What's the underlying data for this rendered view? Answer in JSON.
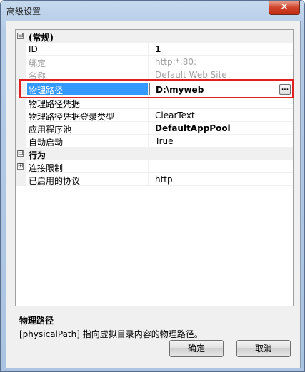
{
  "window": {
    "title": "高级设置",
    "close_symbol": "✕"
  },
  "grid": {
    "rows": [
      {
        "kind": "category",
        "expander": "⊟",
        "label": "(常规)"
      },
      {
        "kind": "prop",
        "name": "ID",
        "value": "1",
        "style": "bold"
      },
      {
        "kind": "prop",
        "name": "绑定",
        "value": "http:*:80:",
        "style": "disabled"
      },
      {
        "kind": "prop",
        "name": "名称",
        "value": "Default Web Site",
        "style": "disabled"
      },
      {
        "kind": "prop",
        "name": "物理路径",
        "value": "D:\\myweb",
        "style": "selected",
        "button": "..."
      },
      {
        "kind": "prop",
        "name": "物理路径凭据",
        "value": ""
      },
      {
        "kind": "prop",
        "name": "物理路径凭据登录类型",
        "value": "ClearText"
      },
      {
        "kind": "prop",
        "name": "应用程序池",
        "value": "DefaultAppPool",
        "style": "bold"
      },
      {
        "kind": "prop",
        "name": "自动启动",
        "value": "True"
      },
      {
        "kind": "category",
        "expander": "⊟",
        "label": "行为"
      },
      {
        "kind": "prop",
        "name": "连接限制",
        "value": "",
        "expander": "⊞"
      },
      {
        "kind": "prop",
        "name": "已启用的协议",
        "value": "http"
      }
    ]
  },
  "description": {
    "title": "物理路径",
    "text": "[physicalPath] 指向虚拟目录内容的物理路径。"
  },
  "buttons": {
    "ok": "确定",
    "cancel": "取消"
  },
  "colors": {
    "selection": "#3399ff",
    "highlight_box": "#e02020"
  }
}
